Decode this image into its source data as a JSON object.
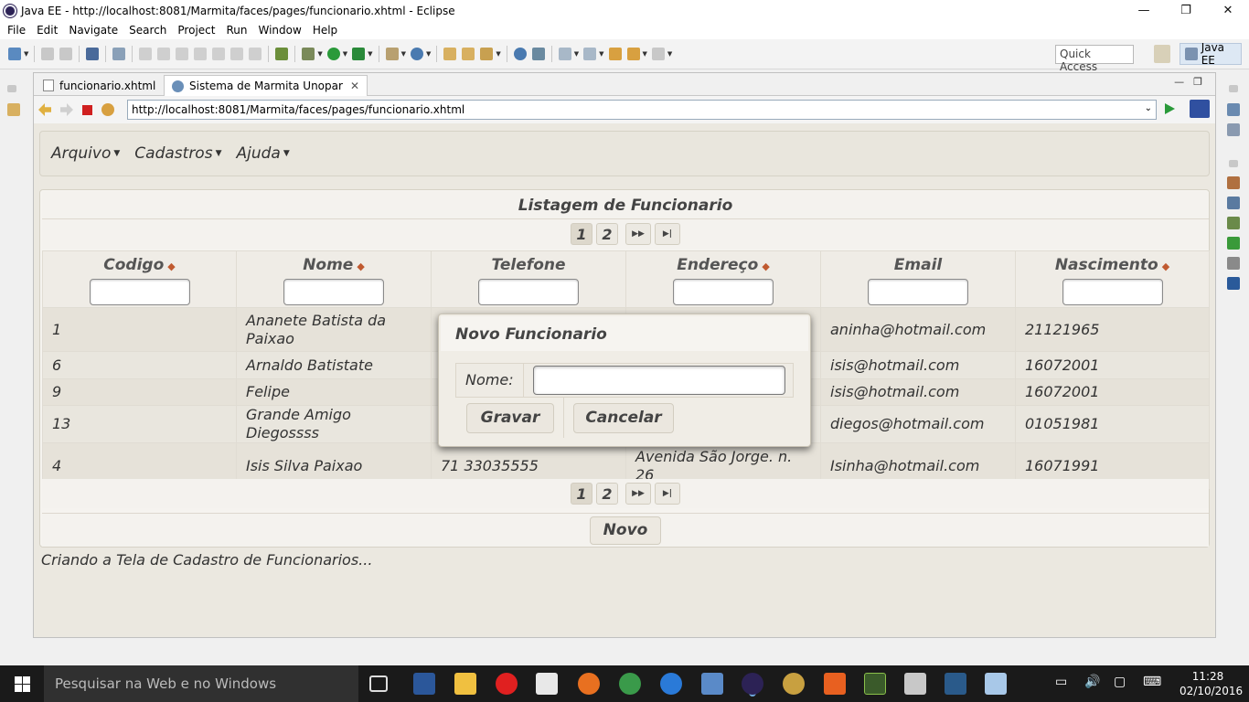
{
  "window": {
    "title": "Java EE - http://localhost:8081/Marmita/faces/pages/funcionario.xhtml - Eclipse",
    "controls": [
      "minimize-icon",
      "restore-icon",
      "close-icon"
    ]
  },
  "menubar": {
    "items": [
      "File",
      "Edit",
      "Navigate",
      "Search",
      "Project",
      "Run",
      "Window",
      "Help"
    ]
  },
  "toolbar": {
    "quick_access_placeholder": "Quick Access",
    "perspective_label": "Java EE"
  },
  "editor": {
    "tabs": [
      {
        "label": "funcionario.xhtml",
        "icon": "file-icon",
        "active": false
      },
      {
        "label": "Sistema de Marmita Unopar",
        "icon": "globe-icon",
        "active": true,
        "closable": true
      }
    ],
    "url": "http://localhost:8081/Marmita/faces/pages/funcionario.xhtml"
  },
  "webpage": {
    "menu": [
      {
        "label": "Arquivo"
      },
      {
        "label": "Cadastros"
      },
      {
        "label": "Ajuda"
      }
    ],
    "table": {
      "title": "Listagem de Funcionario",
      "pages": [
        "1",
        "2"
      ],
      "current_page": "1",
      "nav_next": "▶▶",
      "nav_last": "▶|",
      "columns": [
        {
          "label": "Codigo",
          "sortable": true
        },
        {
          "label": "Nome",
          "sortable": true
        },
        {
          "label": "Telefone",
          "sortable": false
        },
        {
          "label": "Endereço",
          "sortable": true
        },
        {
          "label": "Email",
          "sortable": false
        },
        {
          "label": "Nascimento",
          "sortable": true
        }
      ],
      "rows": [
        {
          "codigo": "1",
          "nome": "Ananete Batista da Paixao",
          "telefone": "",
          "endereco": "",
          "email": "aninha@hotmail.com",
          "nascimento": "21121965"
        },
        {
          "codigo": "6",
          "nome": "Arnaldo Batistate",
          "telefone": "",
          "endereco": "",
          "email": "isis@hotmail.com",
          "nascimento": "16072001"
        },
        {
          "codigo": "9",
          "nome": "Felipe",
          "telefone": "",
          "endereco": "",
          "email": "isis@hotmail.com",
          "nascimento": "16072001"
        },
        {
          "codigo": "13",
          "nome": "Grande Amigo Diegossss",
          "telefone": "",
          "endereco": "",
          "email": "diegos@hotmail.com",
          "nascimento": "01051981"
        },
        {
          "codigo": "4",
          "nome": "Isis Silva Paixao",
          "telefone": "71 33035555",
          "endereco": "Avenida São Jorge. n. 26",
          "email": "Isinha@hotmail.com",
          "nascimento": "16071991"
        }
      ],
      "new_button": "Novo"
    },
    "status_message": "Criando a Tela de Cadastro de Funcionarios...",
    "dialog": {
      "title": "Novo Funcionario",
      "name_label": "Nome:",
      "name_value": "",
      "save_button": "Gravar",
      "cancel_button": "Cancelar"
    }
  },
  "taskbar": {
    "search_placeholder": "Pesquisar na Web e no Windows",
    "time": "11:28",
    "date": "02/10/2016"
  }
}
